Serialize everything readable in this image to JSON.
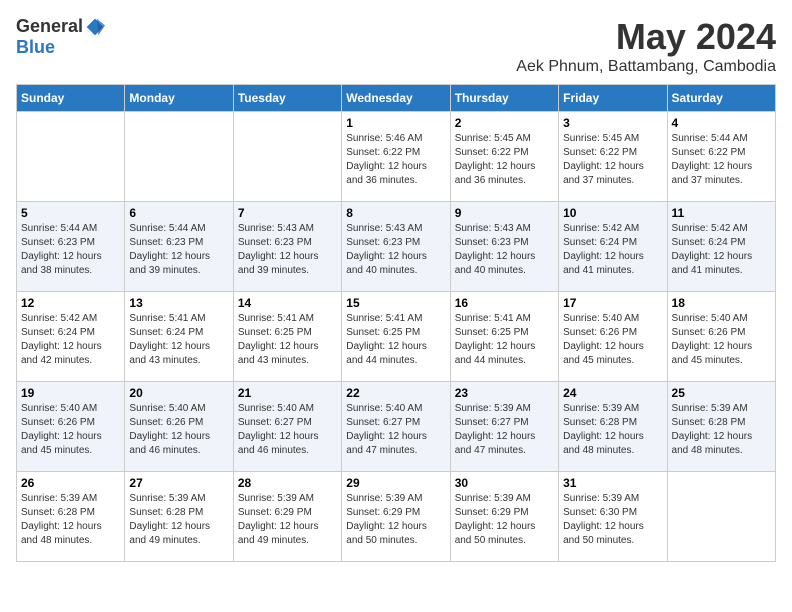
{
  "logo": {
    "general": "General",
    "blue": "Blue"
  },
  "title": {
    "month_year": "May 2024",
    "location": "Aek Phnum, Battambang, Cambodia"
  },
  "weekdays": [
    "Sunday",
    "Monday",
    "Tuesday",
    "Wednesday",
    "Thursday",
    "Friday",
    "Saturday"
  ],
  "weeks": [
    [
      {
        "day": "",
        "sunrise": "",
        "sunset": "",
        "daylight": ""
      },
      {
        "day": "",
        "sunrise": "",
        "sunset": "",
        "daylight": ""
      },
      {
        "day": "",
        "sunrise": "",
        "sunset": "",
        "daylight": ""
      },
      {
        "day": "1",
        "sunrise": "Sunrise: 5:46 AM",
        "sunset": "Sunset: 6:22 PM",
        "daylight": "Daylight: 12 hours and 36 minutes."
      },
      {
        "day": "2",
        "sunrise": "Sunrise: 5:45 AM",
        "sunset": "Sunset: 6:22 PM",
        "daylight": "Daylight: 12 hours and 36 minutes."
      },
      {
        "day": "3",
        "sunrise": "Sunrise: 5:45 AM",
        "sunset": "Sunset: 6:22 PM",
        "daylight": "Daylight: 12 hours and 37 minutes."
      },
      {
        "day": "4",
        "sunrise": "Sunrise: 5:44 AM",
        "sunset": "Sunset: 6:22 PM",
        "daylight": "Daylight: 12 hours and 37 minutes."
      }
    ],
    [
      {
        "day": "5",
        "sunrise": "Sunrise: 5:44 AM",
        "sunset": "Sunset: 6:23 PM",
        "daylight": "Daylight: 12 hours and 38 minutes."
      },
      {
        "day": "6",
        "sunrise": "Sunrise: 5:44 AM",
        "sunset": "Sunset: 6:23 PM",
        "daylight": "Daylight: 12 hours and 39 minutes."
      },
      {
        "day": "7",
        "sunrise": "Sunrise: 5:43 AM",
        "sunset": "Sunset: 6:23 PM",
        "daylight": "Daylight: 12 hours and 39 minutes."
      },
      {
        "day": "8",
        "sunrise": "Sunrise: 5:43 AM",
        "sunset": "Sunset: 6:23 PM",
        "daylight": "Daylight: 12 hours and 40 minutes."
      },
      {
        "day": "9",
        "sunrise": "Sunrise: 5:43 AM",
        "sunset": "Sunset: 6:23 PM",
        "daylight": "Daylight: 12 hours and 40 minutes."
      },
      {
        "day": "10",
        "sunrise": "Sunrise: 5:42 AM",
        "sunset": "Sunset: 6:24 PM",
        "daylight": "Daylight: 12 hours and 41 minutes."
      },
      {
        "day": "11",
        "sunrise": "Sunrise: 5:42 AM",
        "sunset": "Sunset: 6:24 PM",
        "daylight": "Daylight: 12 hours and 41 minutes."
      }
    ],
    [
      {
        "day": "12",
        "sunrise": "Sunrise: 5:42 AM",
        "sunset": "Sunset: 6:24 PM",
        "daylight": "Daylight: 12 hours and 42 minutes."
      },
      {
        "day": "13",
        "sunrise": "Sunrise: 5:41 AM",
        "sunset": "Sunset: 6:24 PM",
        "daylight": "Daylight: 12 hours and 43 minutes."
      },
      {
        "day": "14",
        "sunrise": "Sunrise: 5:41 AM",
        "sunset": "Sunset: 6:25 PM",
        "daylight": "Daylight: 12 hours and 43 minutes."
      },
      {
        "day": "15",
        "sunrise": "Sunrise: 5:41 AM",
        "sunset": "Sunset: 6:25 PM",
        "daylight": "Daylight: 12 hours and 44 minutes."
      },
      {
        "day": "16",
        "sunrise": "Sunrise: 5:41 AM",
        "sunset": "Sunset: 6:25 PM",
        "daylight": "Daylight: 12 hours and 44 minutes."
      },
      {
        "day": "17",
        "sunrise": "Sunrise: 5:40 AM",
        "sunset": "Sunset: 6:26 PM",
        "daylight": "Daylight: 12 hours and 45 minutes."
      },
      {
        "day": "18",
        "sunrise": "Sunrise: 5:40 AM",
        "sunset": "Sunset: 6:26 PM",
        "daylight": "Daylight: 12 hours and 45 minutes."
      }
    ],
    [
      {
        "day": "19",
        "sunrise": "Sunrise: 5:40 AM",
        "sunset": "Sunset: 6:26 PM",
        "daylight": "Daylight: 12 hours and 45 minutes."
      },
      {
        "day": "20",
        "sunrise": "Sunrise: 5:40 AM",
        "sunset": "Sunset: 6:26 PM",
        "daylight": "Daylight: 12 hours and 46 minutes."
      },
      {
        "day": "21",
        "sunrise": "Sunrise: 5:40 AM",
        "sunset": "Sunset: 6:27 PM",
        "daylight": "Daylight: 12 hours and 46 minutes."
      },
      {
        "day": "22",
        "sunrise": "Sunrise: 5:40 AM",
        "sunset": "Sunset: 6:27 PM",
        "daylight": "Daylight: 12 hours and 47 minutes."
      },
      {
        "day": "23",
        "sunrise": "Sunrise: 5:39 AM",
        "sunset": "Sunset: 6:27 PM",
        "daylight": "Daylight: 12 hours and 47 minutes."
      },
      {
        "day": "24",
        "sunrise": "Sunrise: 5:39 AM",
        "sunset": "Sunset: 6:28 PM",
        "daylight": "Daylight: 12 hours and 48 minutes."
      },
      {
        "day": "25",
        "sunrise": "Sunrise: 5:39 AM",
        "sunset": "Sunset: 6:28 PM",
        "daylight": "Daylight: 12 hours and 48 minutes."
      }
    ],
    [
      {
        "day": "26",
        "sunrise": "Sunrise: 5:39 AM",
        "sunset": "Sunset: 6:28 PM",
        "daylight": "Daylight: 12 hours and 48 minutes."
      },
      {
        "day": "27",
        "sunrise": "Sunrise: 5:39 AM",
        "sunset": "Sunset: 6:28 PM",
        "daylight": "Daylight: 12 hours and 49 minutes."
      },
      {
        "day": "28",
        "sunrise": "Sunrise: 5:39 AM",
        "sunset": "Sunset: 6:29 PM",
        "daylight": "Daylight: 12 hours and 49 minutes."
      },
      {
        "day": "29",
        "sunrise": "Sunrise: 5:39 AM",
        "sunset": "Sunset: 6:29 PM",
        "daylight": "Daylight: 12 hours and 50 minutes."
      },
      {
        "day": "30",
        "sunrise": "Sunrise: 5:39 AM",
        "sunset": "Sunset: 6:29 PM",
        "daylight": "Daylight: 12 hours and 50 minutes."
      },
      {
        "day": "31",
        "sunrise": "Sunrise: 5:39 AM",
        "sunset": "Sunset: 6:30 PM",
        "daylight": "Daylight: 12 hours and 50 minutes."
      },
      {
        "day": "",
        "sunrise": "",
        "sunset": "",
        "daylight": ""
      }
    ]
  ]
}
